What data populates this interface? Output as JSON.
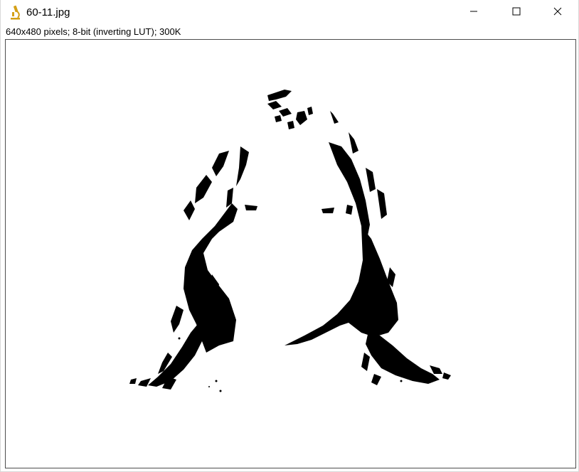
{
  "window": {
    "title": "60-11.jpg",
    "app_icon": "microscope-icon",
    "controls": {
      "minimize": "minimize-icon",
      "maximize": "maximize-icon",
      "close": "close-icon"
    }
  },
  "image_info": "640x480 pixels; 8-bit (inverting LUT); 300K",
  "canvas": {
    "content": "binary-thresholded-image",
    "foreground_color": "#000000",
    "background_color": "#ffffff"
  },
  "colors": {
    "icon_accent": "#d4a017",
    "frame_border": "#4d4d4d"
  }
}
